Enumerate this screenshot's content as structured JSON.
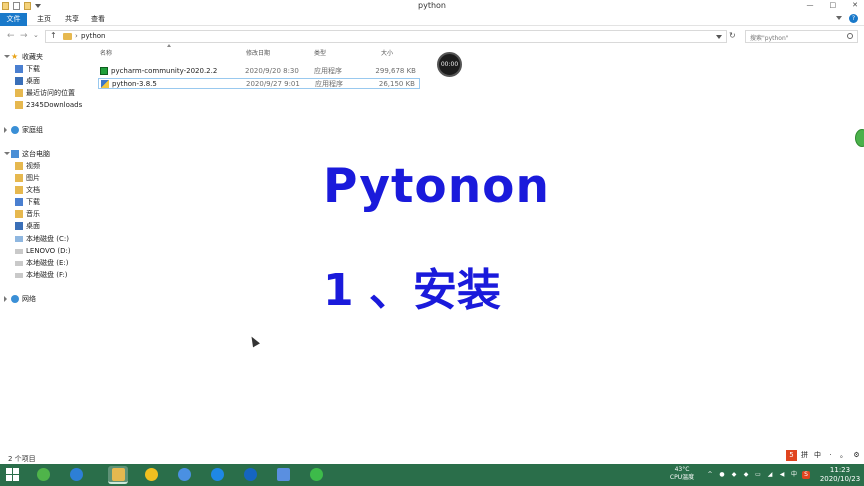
{
  "window": {
    "title": "python",
    "controls": [
      "—",
      "□",
      "✕"
    ]
  },
  "ribbon": {
    "tabs": [
      "文件",
      "主页",
      "共享",
      "查看"
    ]
  },
  "address": {
    "path": "python",
    "search_placeholder": "搜索\"python\""
  },
  "nav_pane": {
    "favorites_header": "收藏夹",
    "favorites": [
      "下载",
      "桌面",
      "最近访问的位置",
      "2345Downloads"
    ],
    "homegroup": "家庭组",
    "this_pc_header": "这台电脑",
    "this_pc": [
      "视频",
      "图片",
      "文档",
      "下载",
      "音乐",
      "桌面",
      "本地磁盘 (C:)",
      "LENOVO (D:)",
      "本地磁盘 (E:)",
      "本地磁盘 (F:)"
    ],
    "network": "网络"
  },
  "columns": {
    "name": "名称",
    "date": "修改日期",
    "type": "类型",
    "size": "大小"
  },
  "files": [
    {
      "name": "pycharm-community-2020.2.2",
      "date": "2020/9/20 8:30",
      "type": "应用程序",
      "size": "299,678 KB"
    },
    {
      "name": "python-3.8.5",
      "date": "2020/9/27 9:01",
      "type": "应用程序",
      "size": "26,150 KB"
    }
  ],
  "recording_timer": "00:00",
  "overlay": {
    "title": "Pytonon",
    "subtitle": "1 、安装"
  },
  "status": {
    "item_count": "2 个项目"
  },
  "ime": [
    "5",
    "拼",
    "中",
    "·",
    "。",
    "⚙"
  ],
  "taskbar": {
    "weather_temp": "43°C",
    "weather_label": "CPU温度",
    "time": "11:23",
    "date": "2020/10/23",
    "ime_indicator": "中"
  },
  "colors": {
    "file_tab": "#1979ca",
    "overlay_text": "#1a1adb",
    "taskbar": "#2a6e4a"
  }
}
